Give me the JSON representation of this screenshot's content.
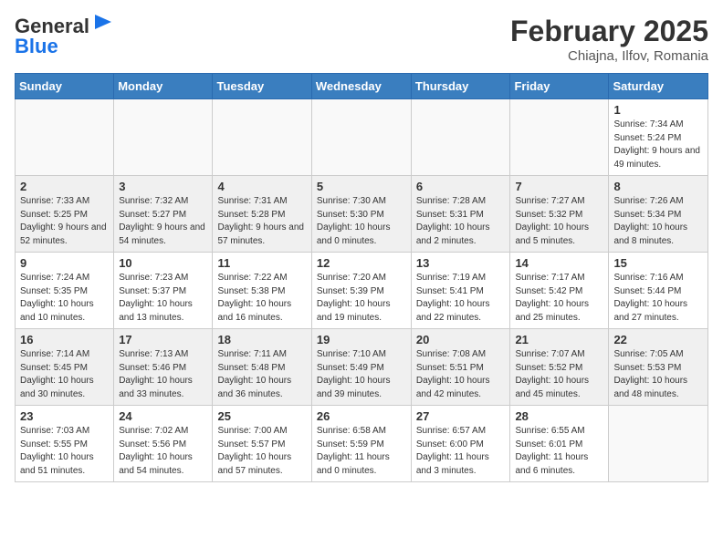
{
  "header": {
    "logo_line1": "General",
    "logo_line2": "Blue",
    "month": "February 2025",
    "location": "Chiajna, Ilfov, Romania"
  },
  "weekdays": [
    "Sunday",
    "Monday",
    "Tuesday",
    "Wednesday",
    "Thursday",
    "Friday",
    "Saturday"
  ],
  "weeks": [
    [
      {
        "day": "",
        "info": ""
      },
      {
        "day": "",
        "info": ""
      },
      {
        "day": "",
        "info": ""
      },
      {
        "day": "",
        "info": ""
      },
      {
        "day": "",
        "info": ""
      },
      {
        "day": "",
        "info": ""
      },
      {
        "day": "1",
        "info": "Sunrise: 7:34 AM\nSunset: 5:24 PM\nDaylight: 9 hours and 49 minutes."
      }
    ],
    [
      {
        "day": "2",
        "info": "Sunrise: 7:33 AM\nSunset: 5:25 PM\nDaylight: 9 hours and 52 minutes."
      },
      {
        "day": "3",
        "info": "Sunrise: 7:32 AM\nSunset: 5:27 PM\nDaylight: 9 hours and 54 minutes."
      },
      {
        "day": "4",
        "info": "Sunrise: 7:31 AM\nSunset: 5:28 PM\nDaylight: 9 hours and 57 minutes."
      },
      {
        "day": "5",
        "info": "Sunrise: 7:30 AM\nSunset: 5:30 PM\nDaylight: 10 hours and 0 minutes."
      },
      {
        "day": "6",
        "info": "Sunrise: 7:28 AM\nSunset: 5:31 PM\nDaylight: 10 hours and 2 minutes."
      },
      {
        "day": "7",
        "info": "Sunrise: 7:27 AM\nSunset: 5:32 PM\nDaylight: 10 hours and 5 minutes."
      },
      {
        "day": "8",
        "info": "Sunrise: 7:26 AM\nSunset: 5:34 PM\nDaylight: 10 hours and 8 minutes."
      }
    ],
    [
      {
        "day": "9",
        "info": "Sunrise: 7:24 AM\nSunset: 5:35 PM\nDaylight: 10 hours and 10 minutes."
      },
      {
        "day": "10",
        "info": "Sunrise: 7:23 AM\nSunset: 5:37 PM\nDaylight: 10 hours and 13 minutes."
      },
      {
        "day": "11",
        "info": "Sunrise: 7:22 AM\nSunset: 5:38 PM\nDaylight: 10 hours and 16 minutes."
      },
      {
        "day": "12",
        "info": "Sunrise: 7:20 AM\nSunset: 5:39 PM\nDaylight: 10 hours and 19 minutes."
      },
      {
        "day": "13",
        "info": "Sunrise: 7:19 AM\nSunset: 5:41 PM\nDaylight: 10 hours and 22 minutes."
      },
      {
        "day": "14",
        "info": "Sunrise: 7:17 AM\nSunset: 5:42 PM\nDaylight: 10 hours and 25 minutes."
      },
      {
        "day": "15",
        "info": "Sunrise: 7:16 AM\nSunset: 5:44 PM\nDaylight: 10 hours and 27 minutes."
      }
    ],
    [
      {
        "day": "16",
        "info": "Sunrise: 7:14 AM\nSunset: 5:45 PM\nDaylight: 10 hours and 30 minutes."
      },
      {
        "day": "17",
        "info": "Sunrise: 7:13 AM\nSunset: 5:46 PM\nDaylight: 10 hours and 33 minutes."
      },
      {
        "day": "18",
        "info": "Sunrise: 7:11 AM\nSunset: 5:48 PM\nDaylight: 10 hours and 36 minutes."
      },
      {
        "day": "19",
        "info": "Sunrise: 7:10 AM\nSunset: 5:49 PM\nDaylight: 10 hours and 39 minutes."
      },
      {
        "day": "20",
        "info": "Sunrise: 7:08 AM\nSunset: 5:51 PM\nDaylight: 10 hours and 42 minutes."
      },
      {
        "day": "21",
        "info": "Sunrise: 7:07 AM\nSunset: 5:52 PM\nDaylight: 10 hours and 45 minutes."
      },
      {
        "day": "22",
        "info": "Sunrise: 7:05 AM\nSunset: 5:53 PM\nDaylight: 10 hours and 48 minutes."
      }
    ],
    [
      {
        "day": "23",
        "info": "Sunrise: 7:03 AM\nSunset: 5:55 PM\nDaylight: 10 hours and 51 minutes."
      },
      {
        "day": "24",
        "info": "Sunrise: 7:02 AM\nSunset: 5:56 PM\nDaylight: 10 hours and 54 minutes."
      },
      {
        "day": "25",
        "info": "Sunrise: 7:00 AM\nSunset: 5:57 PM\nDaylight: 10 hours and 57 minutes."
      },
      {
        "day": "26",
        "info": "Sunrise: 6:58 AM\nSunset: 5:59 PM\nDaylight: 11 hours and 0 minutes."
      },
      {
        "day": "27",
        "info": "Sunrise: 6:57 AM\nSunset: 6:00 PM\nDaylight: 11 hours and 3 minutes."
      },
      {
        "day": "28",
        "info": "Sunrise: 6:55 AM\nSunset: 6:01 PM\nDaylight: 11 hours and 6 minutes."
      },
      {
        "day": "",
        "info": ""
      }
    ]
  ]
}
